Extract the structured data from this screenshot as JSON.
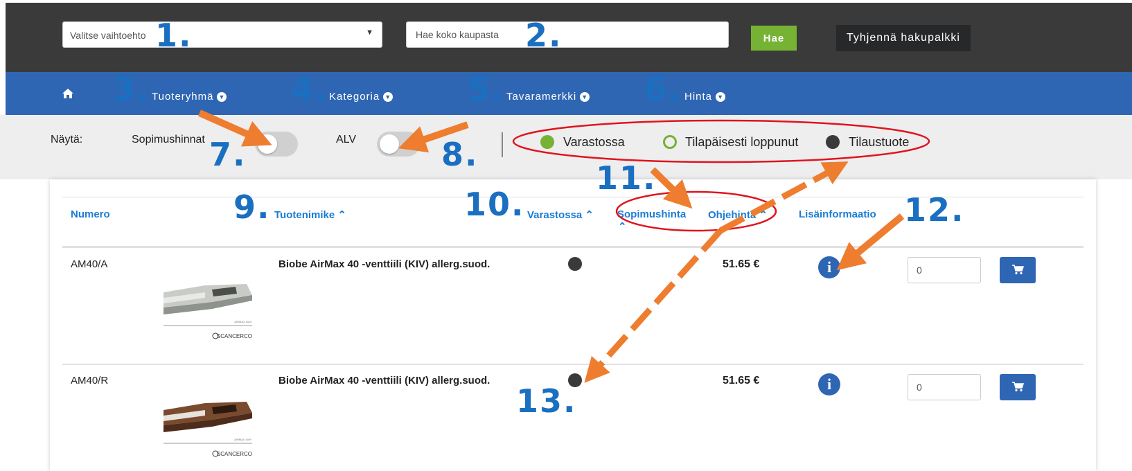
{
  "search": {
    "select_value": "Valitse vaihtoehto",
    "search_placeholder": "Hae koko kaupasta",
    "search_button": "Hae",
    "clear_button": "Tyhjennä hakupalkki"
  },
  "nav": {
    "items": [
      {
        "label": "Tuoteryhmä"
      },
      {
        "label": "Kategoria"
      },
      {
        "label": "Tavaramerkki"
      },
      {
        "label": "Hinta"
      }
    ]
  },
  "filters": {
    "show_label": "Näytä:",
    "contract_prices_label": "Sopimushinnat",
    "vat_label": "ALV",
    "contract_prices_on": false,
    "vat_on": false
  },
  "legend": [
    {
      "label": "Varastossa",
      "color": "#76b233",
      "style": "filled"
    },
    {
      "label": "Tilapäisesti loppunut",
      "color": "#76b233",
      "style": "outline"
    },
    {
      "label": "Tilaustuote",
      "color": "#3a3a3a",
      "style": "filled"
    }
  ],
  "table": {
    "headers": {
      "number": "Numero",
      "name": "Tuotenimike",
      "stock": "Varastossa",
      "contract_price": "Sopimushinta",
      "list_price": "Ohjehinta",
      "info": "Lisäinformaatio"
    },
    "rows": [
      {
        "number": "AM40/A",
        "name": "Biobe AirMax 40 -venttiili (KIV) allerg.suod.",
        "price": "51.65 €",
        "qty": "0",
        "image_brand": "SCANCERCO",
        "image_caption": "AIRMAX 40/A"
      },
      {
        "number": "AM40/R",
        "name": "Biobe AirMax 40 -venttiili (KIV) allerg.suod.",
        "price": "51.65 €",
        "qty": "0",
        "image_brand": "SCANCERCO",
        "image_caption": "AIRMAX 40/R"
      }
    ]
  },
  "annotations": {
    "n1": "1.",
    "n2": "2.",
    "n3": "3.",
    "n4": "4.",
    "n5": "5.",
    "n6": "6.",
    "n7": "7.",
    "n8": "8.",
    "n9": "9.",
    "n10": "10.",
    "n11": "11.",
    "n12": "12.",
    "n13": "13."
  },
  "colors": {
    "accent_blue": "#2f66b3",
    "link_blue": "#1a7cd4",
    "search_green": "#76b233",
    "annotation_orange": "#ee7d2f",
    "annotation_red": "#e0141e",
    "annotation_number": "#1a6fc0"
  }
}
